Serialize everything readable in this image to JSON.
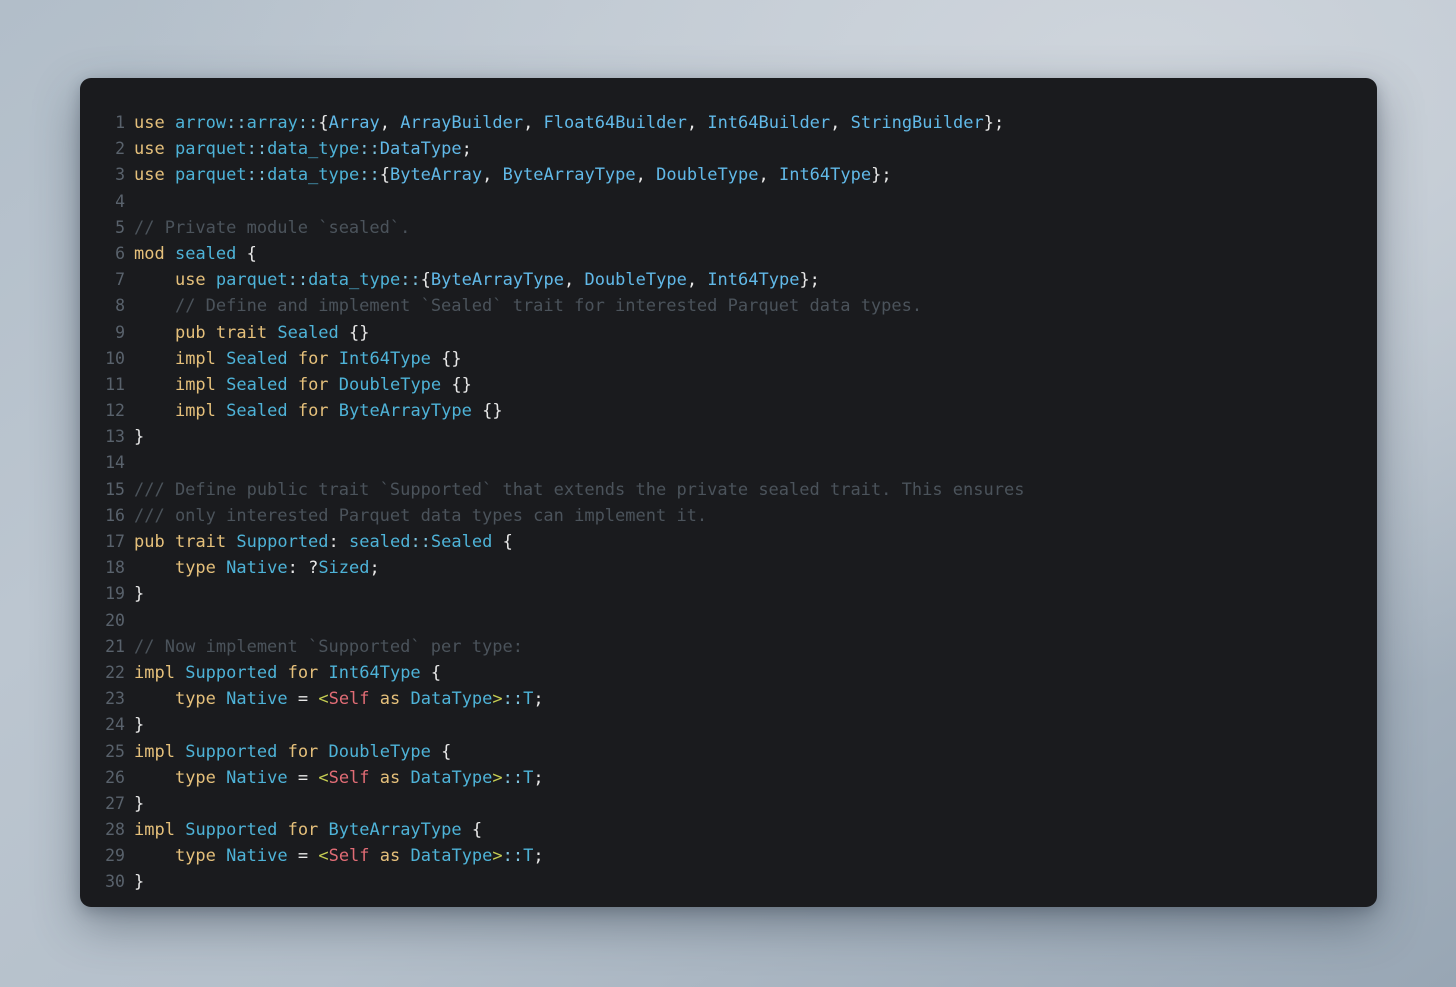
{
  "window": {
    "kind": "code-snippet-panel",
    "language": "rust",
    "background_color": "#1a1b1e",
    "line_number_color": "#59626c"
  },
  "theme": {
    "keyword": "#e5c07b",
    "type": "#4eb3d8",
    "type_bright": "#61b9e8",
    "punctuation": "#e8e8e8",
    "path_separator": "#7ec4e0",
    "comment": "#4b535b",
    "self_keyword": "#e06c75",
    "angle_bracket": "#c6ce52",
    "page_background": "#b2bec9"
  },
  "code": {
    "line_numbers": [
      "1",
      "2",
      "3",
      "4",
      "5",
      "6",
      "7",
      "8",
      "9",
      "10",
      "11",
      "12",
      "13",
      "14",
      "15",
      "16",
      "17",
      "18",
      "19",
      "20",
      "21",
      "22",
      "23",
      "24",
      "25",
      "26",
      "27",
      "28",
      "29",
      "30"
    ],
    "lines": [
      "use arrow::array::{Array, ArrayBuilder, Float64Builder, Int64Builder, StringBuilder};",
      "use parquet::data_type::DataType;",
      "use parquet::data_type::{ByteArray, ByteArrayType, DoubleType, Int64Type};",
      "",
      "// Private module `sealed`.",
      "mod sealed {",
      "    use parquet::data_type::{ByteArrayType, DoubleType, Int64Type};",
      "    // Define and implement `Sealed` trait for interested Parquet data types.",
      "    pub trait Sealed {}",
      "    impl Sealed for Int64Type {}",
      "    impl Sealed for DoubleType {}",
      "    impl Sealed for ByteArrayType {}",
      "}",
      "",
      "/// Define public trait `Supported` that extends the private sealed trait. This ensures",
      "/// only interested Parquet data types can implement it.",
      "pub trait Supported: sealed::Sealed {",
      "    type Native: ?Sized;",
      "}",
      "",
      "// Now implement `Supported` per type:",
      "impl Supported for Int64Type {",
      "    type Native = <Self as DataType>::T;",
      "}",
      "impl Supported for DoubleType {",
      "    type Native = <Self as DataType>::T;",
      "}",
      "impl Supported for ByteArrayType {",
      "    type Native = <Self as DataType>::T;",
      "}"
    ],
    "tokens": [
      [
        [
          "use",
          "kw"
        ],
        [
          " ",
          "pun"
        ],
        [
          "arrow",
          "ty"
        ],
        [
          "::",
          "sep"
        ],
        [
          "array",
          "ty"
        ],
        [
          "::",
          "sep"
        ],
        [
          "{",
          "pun"
        ],
        [
          "Array",
          "tyb"
        ],
        [
          ", ",
          "pun"
        ],
        [
          "ArrayBuilder",
          "tyb"
        ],
        [
          ", ",
          "pun"
        ],
        [
          "Float64Builder",
          "tyb"
        ],
        [
          ", ",
          "pun"
        ],
        [
          "Int64Builder",
          "tyb"
        ],
        [
          ", ",
          "pun"
        ],
        [
          "StringBuilder",
          "tyb"
        ],
        [
          "};",
          "pun"
        ]
      ],
      [
        [
          "use",
          "kw"
        ],
        [
          " ",
          "pun"
        ],
        [
          "parquet",
          "ty"
        ],
        [
          "::",
          "sep"
        ],
        [
          "data_type",
          "ty"
        ],
        [
          "::",
          "sep"
        ],
        [
          "DataType",
          "tyb"
        ],
        [
          ";",
          "pun"
        ]
      ],
      [
        [
          "use",
          "kw"
        ],
        [
          " ",
          "pun"
        ],
        [
          "parquet",
          "ty"
        ],
        [
          "::",
          "sep"
        ],
        [
          "data_type",
          "ty"
        ],
        [
          "::",
          "sep"
        ],
        [
          "{",
          "pun"
        ],
        [
          "ByteArray",
          "tyb"
        ],
        [
          ", ",
          "pun"
        ],
        [
          "ByteArrayType",
          "tyb"
        ],
        [
          ", ",
          "pun"
        ],
        [
          "DoubleType",
          "tyb"
        ],
        [
          ", ",
          "pun"
        ],
        [
          "Int64Type",
          "tyb"
        ],
        [
          "};",
          "pun"
        ]
      ],
      [],
      [
        [
          "// Private module `sealed`.",
          "cm"
        ]
      ],
      [
        [
          "mod",
          "kw"
        ],
        [
          " ",
          "pun"
        ],
        [
          "sealed",
          "ty"
        ],
        [
          " ",
          "pun"
        ],
        [
          "{",
          "pun"
        ]
      ],
      [
        [
          "    ",
          "pun"
        ],
        [
          "use",
          "kw"
        ],
        [
          " ",
          "pun"
        ],
        [
          "parquet",
          "ty"
        ],
        [
          "::",
          "sep"
        ],
        [
          "data_type",
          "ty"
        ],
        [
          "::",
          "sep"
        ],
        [
          "{",
          "pun"
        ],
        [
          "ByteArrayType",
          "tyb"
        ],
        [
          ", ",
          "pun"
        ],
        [
          "DoubleType",
          "tyb"
        ],
        [
          ", ",
          "pun"
        ],
        [
          "Int64Type",
          "tyb"
        ],
        [
          "};",
          "pun"
        ]
      ],
      [
        [
          "    ",
          "pun"
        ],
        [
          "// Define and implement `Sealed` trait for interested Parquet data types.",
          "cm"
        ]
      ],
      [
        [
          "    ",
          "pun"
        ],
        [
          "pub",
          "kw"
        ],
        [
          " ",
          "pun"
        ],
        [
          "trait",
          "kw"
        ],
        [
          " ",
          "pun"
        ],
        [
          "Sealed",
          "ty"
        ],
        [
          " ",
          "pun"
        ],
        [
          "{}",
          "pun"
        ]
      ],
      [
        [
          "    ",
          "pun"
        ],
        [
          "impl",
          "kw"
        ],
        [
          " ",
          "pun"
        ],
        [
          "Sealed",
          "ty"
        ],
        [
          " ",
          "pun"
        ],
        [
          "for",
          "kw"
        ],
        [
          " ",
          "pun"
        ],
        [
          "Int64Type",
          "ty"
        ],
        [
          " ",
          "pun"
        ],
        [
          "{}",
          "pun"
        ]
      ],
      [
        [
          "    ",
          "pun"
        ],
        [
          "impl",
          "kw"
        ],
        [
          " ",
          "pun"
        ],
        [
          "Sealed",
          "ty"
        ],
        [
          " ",
          "pun"
        ],
        [
          "for",
          "kw"
        ],
        [
          " ",
          "pun"
        ],
        [
          "DoubleType",
          "ty"
        ],
        [
          " ",
          "pun"
        ],
        [
          "{}",
          "pun"
        ]
      ],
      [
        [
          "    ",
          "pun"
        ],
        [
          "impl",
          "kw"
        ],
        [
          " ",
          "pun"
        ],
        [
          "Sealed",
          "ty"
        ],
        [
          " ",
          "pun"
        ],
        [
          "for",
          "kw"
        ],
        [
          " ",
          "pun"
        ],
        [
          "ByteArrayType",
          "ty"
        ],
        [
          " ",
          "pun"
        ],
        [
          "{}",
          "pun"
        ]
      ],
      [
        [
          "}",
          "pun"
        ]
      ],
      [],
      [
        [
          "/// Define public trait `Supported` that extends the private sealed trait. This ensures",
          "cm"
        ]
      ],
      [
        [
          "/// only interested Parquet data types can implement it.",
          "cm"
        ]
      ],
      [
        [
          "pub",
          "kw"
        ],
        [
          " ",
          "pun"
        ],
        [
          "trait",
          "kw"
        ],
        [
          " ",
          "pun"
        ],
        [
          "Supported",
          "ty"
        ],
        [
          ": ",
          "pun"
        ],
        [
          "sealed",
          "ty"
        ],
        [
          "::",
          "sep"
        ],
        [
          "Sealed",
          "ty"
        ],
        [
          " ",
          "pun"
        ],
        [
          "{",
          "pun"
        ]
      ],
      [
        [
          "    ",
          "pun"
        ],
        [
          "type",
          "kw"
        ],
        [
          " ",
          "pun"
        ],
        [
          "Native",
          "ty"
        ],
        [
          ": ",
          "pun"
        ],
        [
          "?",
          "op"
        ],
        [
          "Sized",
          "ty"
        ],
        [
          ";",
          "pun"
        ]
      ],
      [
        [
          "}",
          "pun"
        ]
      ],
      [],
      [
        [
          "// Now implement `Supported` per type:",
          "cm"
        ]
      ],
      [
        [
          "impl",
          "kw"
        ],
        [
          " ",
          "pun"
        ],
        [
          "Supported",
          "ty"
        ],
        [
          " ",
          "pun"
        ],
        [
          "for",
          "kw"
        ],
        [
          " ",
          "pun"
        ],
        [
          "Int64Type",
          "ty"
        ],
        [
          " ",
          "pun"
        ],
        [
          "{",
          "pun"
        ]
      ],
      [
        [
          "    ",
          "pun"
        ],
        [
          "type",
          "kw"
        ],
        [
          " ",
          "pun"
        ],
        [
          "Native",
          "ty"
        ],
        [
          " ",
          "pun"
        ],
        [
          "=",
          "op"
        ],
        [
          " ",
          "pun"
        ],
        [
          "<",
          "ang"
        ],
        [
          "Self",
          "slf"
        ],
        [
          " ",
          "pun"
        ],
        [
          "as",
          "kw"
        ],
        [
          " ",
          "pun"
        ],
        [
          "DataType",
          "ty"
        ],
        [
          ">",
          "ang"
        ],
        [
          "::",
          "sep"
        ],
        [
          "T",
          "ty"
        ],
        [
          ";",
          "pun"
        ]
      ],
      [
        [
          "}",
          "pun"
        ]
      ],
      [
        [
          "impl",
          "kw"
        ],
        [
          " ",
          "pun"
        ],
        [
          "Supported",
          "ty"
        ],
        [
          " ",
          "pun"
        ],
        [
          "for",
          "kw"
        ],
        [
          " ",
          "pun"
        ],
        [
          "DoubleType",
          "ty"
        ],
        [
          " ",
          "pun"
        ],
        [
          "{",
          "pun"
        ]
      ],
      [
        [
          "    ",
          "pun"
        ],
        [
          "type",
          "kw"
        ],
        [
          " ",
          "pun"
        ],
        [
          "Native",
          "ty"
        ],
        [
          " ",
          "pun"
        ],
        [
          "=",
          "op"
        ],
        [
          " ",
          "pun"
        ],
        [
          "<",
          "ang"
        ],
        [
          "Self",
          "slf"
        ],
        [
          " ",
          "pun"
        ],
        [
          "as",
          "kw"
        ],
        [
          " ",
          "pun"
        ],
        [
          "DataType",
          "ty"
        ],
        [
          ">",
          "ang"
        ],
        [
          "::",
          "sep"
        ],
        [
          "T",
          "ty"
        ],
        [
          ";",
          "pun"
        ]
      ],
      [
        [
          "}",
          "pun"
        ]
      ],
      [
        [
          "impl",
          "kw"
        ],
        [
          " ",
          "pun"
        ],
        [
          "Supported",
          "ty"
        ],
        [
          " ",
          "pun"
        ],
        [
          "for",
          "kw"
        ],
        [
          " ",
          "pun"
        ],
        [
          "ByteArrayType",
          "ty"
        ],
        [
          " ",
          "pun"
        ],
        [
          "{",
          "pun"
        ]
      ],
      [
        [
          "    ",
          "pun"
        ],
        [
          "type",
          "kw"
        ],
        [
          " ",
          "pun"
        ],
        [
          "Native",
          "ty"
        ],
        [
          " ",
          "pun"
        ],
        [
          "=",
          "op"
        ],
        [
          " ",
          "pun"
        ],
        [
          "<",
          "ang"
        ],
        [
          "Self",
          "slf"
        ],
        [
          " ",
          "pun"
        ],
        [
          "as",
          "kw"
        ],
        [
          " ",
          "pun"
        ],
        [
          "DataType",
          "ty"
        ],
        [
          ">",
          "ang"
        ],
        [
          "::",
          "sep"
        ],
        [
          "T",
          "ty"
        ],
        [
          ";",
          "pun"
        ]
      ],
      [
        [
          "}",
          "pun"
        ]
      ]
    ]
  }
}
